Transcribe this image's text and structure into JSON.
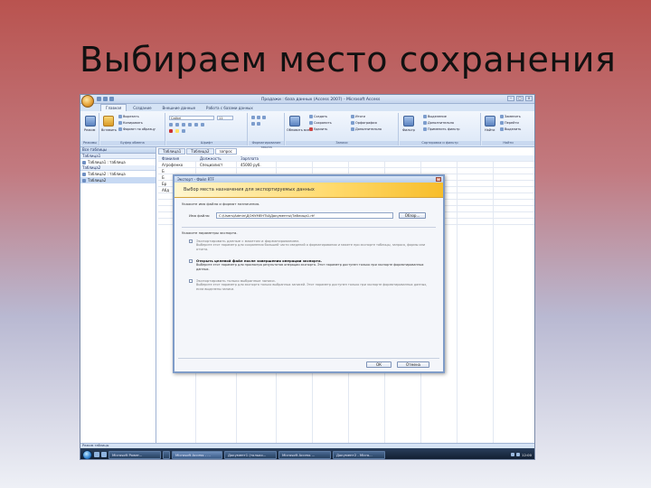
{
  "slide": {
    "title": "Выбираем место сохранения"
  },
  "app": {
    "window_title": "Продажи : база данных (Access 2007) - Microsoft Access",
    "ribbon_tabs": [
      "Главная",
      "Создание",
      "Внешние данные",
      "Работа с базами данных"
    ],
    "groups": {
      "views": {
        "label": "Режимы",
        "btn": "Режим"
      },
      "clipboard": {
        "label": "Буфер обмена",
        "btn": "Вставить",
        "cut": "Вырезать",
        "copy": "Копировать",
        "format": "Формат по образцу"
      },
      "font": {
        "label": "Шрифт",
        "font_name": "Calibri",
        "font_size": "11"
      },
      "rich_text": {
        "label": "Форматирование текста"
      },
      "records": {
        "label": "Записи",
        "refresh": "Обновить все",
        "new": "Создать",
        "save": "Сохранить",
        "delete": "Удалить",
        "totals": "Итоги",
        "spelling": "Орфография",
        "more": "Дополнительно"
      },
      "sort": {
        "label": "Сортировка и фильтр",
        "filter": "Фильтр",
        "selection": "Выделение",
        "advanced": "Дополнительно",
        "toggle": "Применить фильтр"
      },
      "find": {
        "label": "Найти",
        "find": "Найти",
        "replace": "Заменить",
        "goto": "Перейти",
        "select": "Выделить"
      }
    },
    "nav": {
      "header": "Все таблицы",
      "groups": [
        {
          "name": "Таблица1",
          "items": [
            "Таблица1 : таблица"
          ]
        },
        {
          "name": "Таблица2",
          "items": [
            "Таблица2 : таблица",
            "Таблица2"
          ]
        }
      ]
    },
    "doc_tabs": [
      "Таблица1",
      "Таблица2",
      "запрос"
    ],
    "sheet": {
      "headers": [
        "Фамилия",
        "Должность",
        "Зарплата"
      ],
      "rows": [
        [
          "Агрофенко",
          "Специалист",
          "45000 руб."
        ],
        [
          "Б",
          "",
          ""
        ],
        [
          "Б",
          "",
          ""
        ],
        [
          "Бр",
          "",
          ""
        ],
        [
          "Абд",
          "",
          ""
        ]
      ]
    },
    "status": "Режим таблицы",
    "taskbar": {
      "buttons": [
        "Microsoft Power...",
        "",
        "Microsoft Access - ...",
        "Документ1 (только...",
        "Microsoft Access ...",
        "Документ2 - Micro..."
      ],
      "clock": "12:00"
    }
  },
  "dialog": {
    "title": "Экспорт - Файл RTF",
    "close": "×",
    "header": "Выбор места назначения для экспортируемых данных",
    "intro": "Укажите имя файла и формат назначения.",
    "file_label": "Имя файла:",
    "file_value": "C:\\Users\\Admin\\ДОКУМЕНТЫ\\Документы\\Таблица1.rtf",
    "browse": "Обзор...",
    "options_label": "Укажите параметры экспорта.",
    "opt1": "Экспортировать данные с макетом и форматированием.",
    "opt1_desc": "Выберите этот параметр для сохранения большей части сведений о форматировании и макете при экспорте таблицы, запроса, формы или отчета.",
    "opt2": "Открыть целевой файл после завершения операции экспорта.",
    "opt2_desc": "Выберите этот параметр для просмотра результатов операции экспорта. Этот параметр доступен только при экспорте форматированных данных.",
    "opt3": "Экспортировать только выбранные записи.",
    "opt3_desc": "Выберите этот параметр для экспорта только выбранных записей. Этот параметр доступен только при экспорте форматированных данных, если выделены записи.",
    "ok": "ОК",
    "cancel": "Отмена"
  },
  "colors": {
    "accent": "#ffd96a",
    "window_border": "#7f9cc8"
  }
}
